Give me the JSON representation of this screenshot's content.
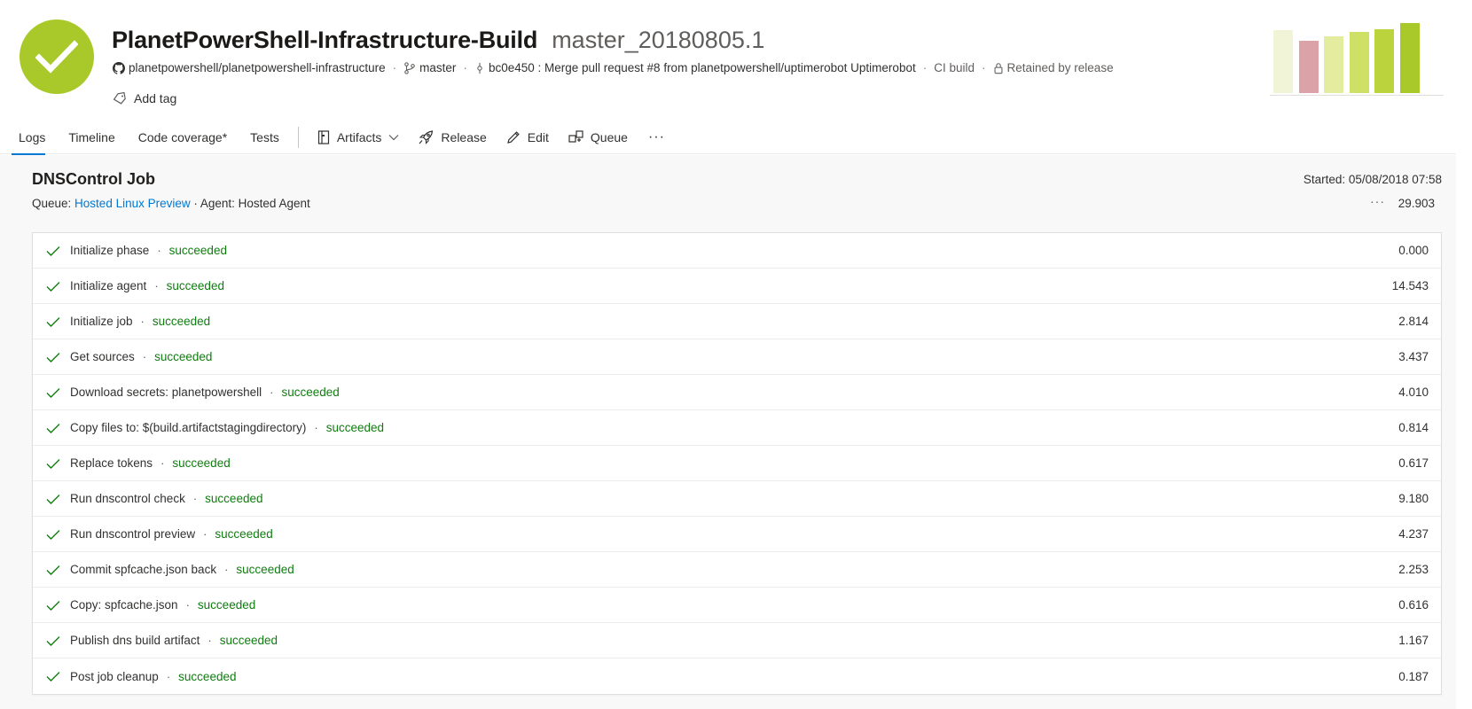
{
  "header": {
    "title": "PlanetPowerShell-Infrastructure-Build",
    "build_number": "master_20180805.1",
    "repo": "planetpowershell/planetpowershell-infrastructure",
    "branch": "master",
    "commit": "bc0e450 : Merge pull request #8 from planetpowershell/uptimerobot Uptimerobot",
    "reason": "CI build",
    "retention": "Retained by release",
    "add_tag_label": "Add tag",
    "status_color": "#a9c92b"
  },
  "history": {
    "bars": [
      {
        "level": 0.84,
        "color": "#f1f4d6"
      },
      {
        "level": 0.7,
        "color": "#dba3a8"
      },
      {
        "level": 0.76,
        "color": "#e3ec9f"
      },
      {
        "level": 0.82,
        "color": "#cfe066"
      },
      {
        "level": 0.86,
        "color": "#bbd33d"
      },
      {
        "level": 0.94,
        "color": "#a9c92b"
      }
    ]
  },
  "tabs": [
    {
      "label": "Logs",
      "active": true
    },
    {
      "label": "Timeline",
      "active": false
    },
    {
      "label": "Code coverage*",
      "active": false
    },
    {
      "label": "Tests",
      "active": false
    }
  ],
  "toolbar": {
    "artifacts_label": "Artifacts",
    "release_label": "Release",
    "edit_label": "Edit",
    "queue_label": "Queue",
    "more_label": "···"
  },
  "job": {
    "title": "DNSControl Job",
    "started": "Started: 05/08/2018 07:58",
    "queue_prefix": "Queue: ",
    "queue_name": "Hosted Linux Preview",
    "agent": " · Agent: Hosted Agent",
    "more_label": "···",
    "duration": "29.903"
  },
  "steps": [
    {
      "name": "Initialize phase",
      "status": "succeeded",
      "duration": "0.000"
    },
    {
      "name": "Initialize agent",
      "status": "succeeded",
      "duration": "14.543"
    },
    {
      "name": "Initialize job",
      "status": "succeeded",
      "duration": "2.814"
    },
    {
      "name": "Get sources",
      "status": "succeeded",
      "duration": "3.437"
    },
    {
      "name": "Download secrets: planetpowershell",
      "status": "succeeded",
      "duration": "4.010"
    },
    {
      "name": "Copy files to: $(build.artifactstagingdirectory)",
      "status": "succeeded",
      "duration": "0.814"
    },
    {
      "name": "Replace tokens",
      "status": "succeeded",
      "duration": "0.617"
    },
    {
      "name": "Run dnscontrol check",
      "status": "succeeded",
      "duration": "9.180"
    },
    {
      "name": "Run dnscontrol preview",
      "status": "succeeded",
      "duration": "4.237"
    },
    {
      "name": "Commit spfcache.json back",
      "status": "succeeded",
      "duration": "2.253"
    },
    {
      "name": "Copy: spfcache.json",
      "status": "succeeded",
      "duration": "0.616"
    },
    {
      "name": "Publish dns build artifact",
      "status": "succeeded",
      "duration": "1.167"
    },
    {
      "name": "Post job cleanup",
      "status": "succeeded",
      "duration": "0.187"
    }
  ]
}
